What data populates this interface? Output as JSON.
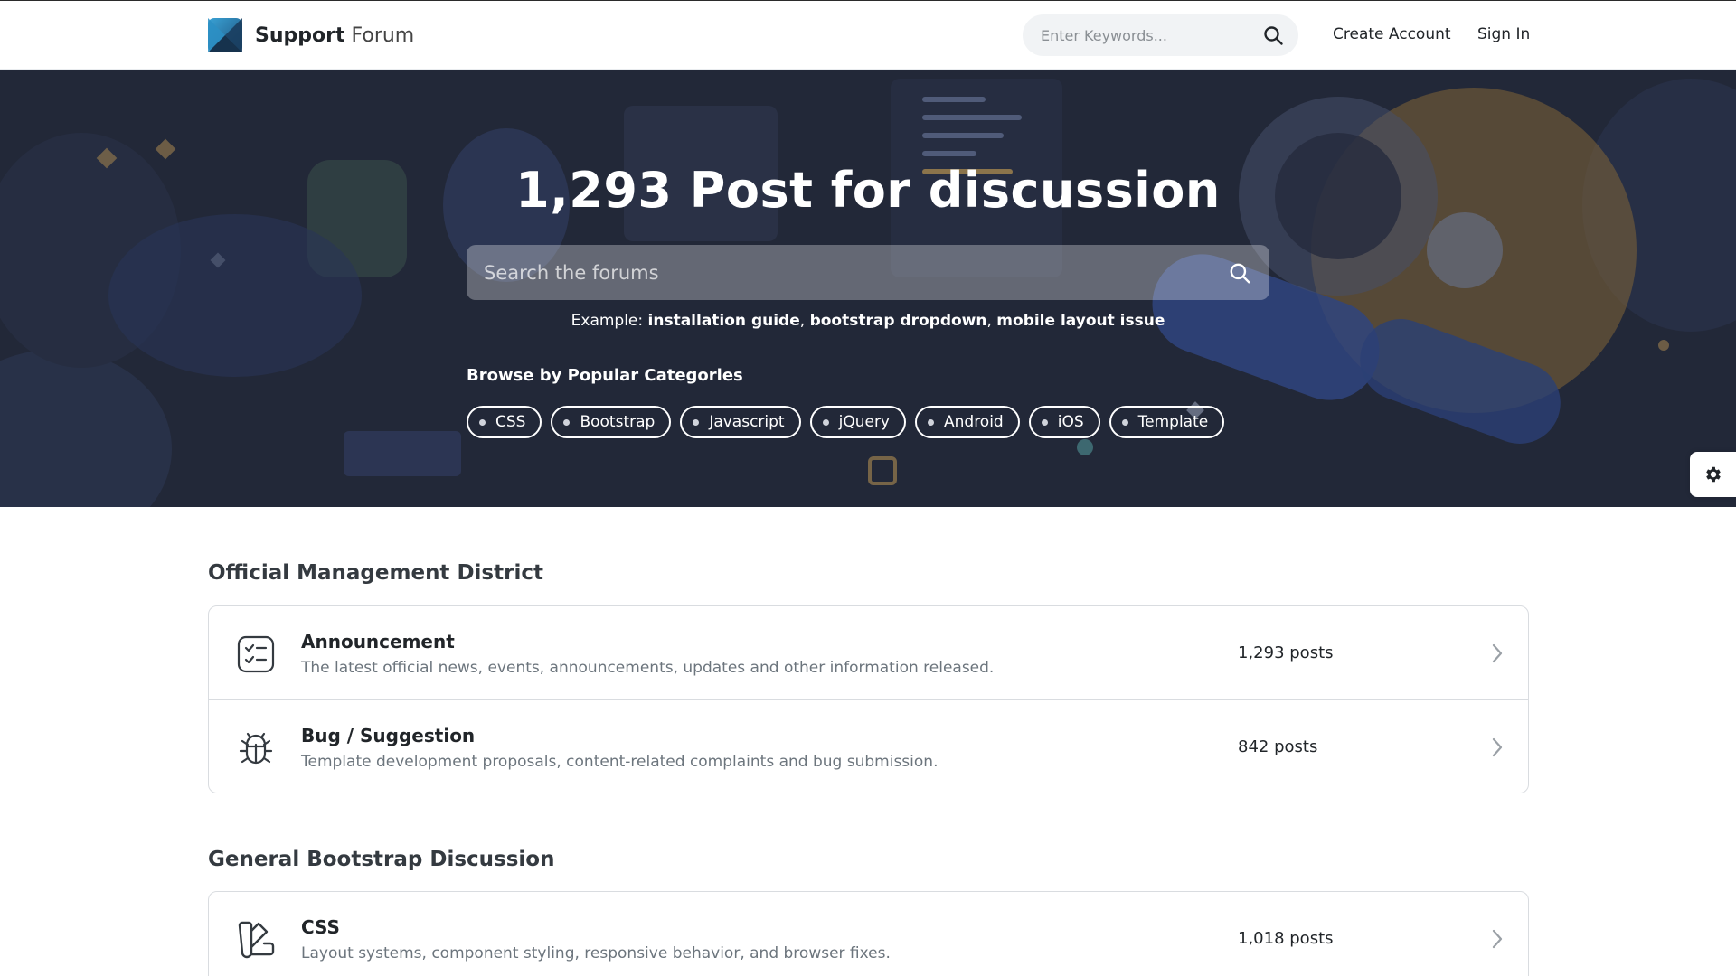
{
  "navbar": {
    "brand_bold": "Support",
    "brand_light": "Forum",
    "search_placeholder": "Enter Keywords...",
    "create_account": "Create Account",
    "sign_in": "Sign In"
  },
  "hero": {
    "title": "1,293 Post for discussion",
    "search_placeholder": "Search the forums",
    "example_prefix": "Example:",
    "examples": [
      "installation guide",
      "bootstrap dropdown",
      "mobile layout issue"
    ],
    "browse_label": "Browse by Popular Categories",
    "categories": [
      "CSS",
      "Bootstrap",
      "Javascript",
      "jQuery",
      "Android",
      "iOS",
      "Template"
    ]
  },
  "sections": [
    {
      "title": "Official Management District",
      "forums": [
        {
          "title": "Announcement",
          "description": "The latest official news, events, announcements, updates and other information released.",
          "count": "1,293 posts",
          "icon": "checklist-icon"
        },
        {
          "title": "Bug / Suggestion",
          "description": "Template development proposals, content-related complaints and bug submission.",
          "count": "842 posts",
          "icon": "bug-icon"
        }
      ]
    },
    {
      "title": "General Bootstrap Discussion",
      "forums": [
        {
          "title": "CSS",
          "description": "Layout systems, component styling, responsive behavior, and browser fixes.",
          "count": "1,018 posts",
          "icon": "swatch-icon"
        }
      ]
    }
  ],
  "colors": {
    "hero_bg": "#262b3c",
    "accent_blue": "#3b57a8",
    "accent_gold": "#d9a441",
    "text_dark": "#212529",
    "text_muted": "#6c757d"
  }
}
